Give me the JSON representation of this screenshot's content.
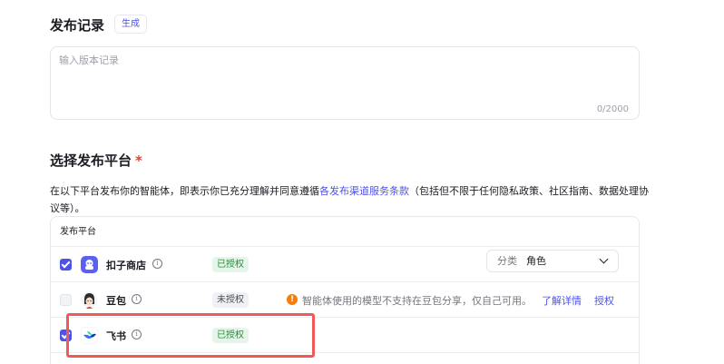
{
  "release": {
    "title": "发布记录",
    "generate_label": "生成",
    "placeholder": "输入版本记录",
    "counter": "0/2000"
  },
  "platform_section": {
    "title": "选择发布平台",
    "required_mark": "*",
    "desc_prefix": "在以下平台发布你的智能体，即表示你已充分理解并同意遵循",
    "desc_link": "各发布渠道服务条款",
    "desc_suffix": "（包括但不限于任何隐私政策、社区指南、数据处理协议等）。",
    "table_header": "发布平台",
    "rows": [
      {
        "name": "扣子商店",
        "checked": true,
        "status": "已授权",
        "category_label": "分类",
        "category_value": "角色"
      },
      {
        "name": "豆包",
        "checked": false,
        "status": "未授权",
        "warning": "智能体使用的模型不支持在豆包分享，仅自己可用。",
        "learn_more": "了解详情",
        "authorize": "授权"
      },
      {
        "name": "飞书",
        "checked": true,
        "status": "已授权"
      }
    ]
  },
  "icons": {
    "info": "info-circle-icon",
    "warning": "warning-circle-icon",
    "chevron": "chevron-down-icon"
  },
  "colors": {
    "accent": "#4d53e8",
    "authorized_bg": "#e5f5e9",
    "authorized_text": "#2a8c3a",
    "warning": "#f47e0c",
    "highlight_border": "#ef5a58"
  }
}
